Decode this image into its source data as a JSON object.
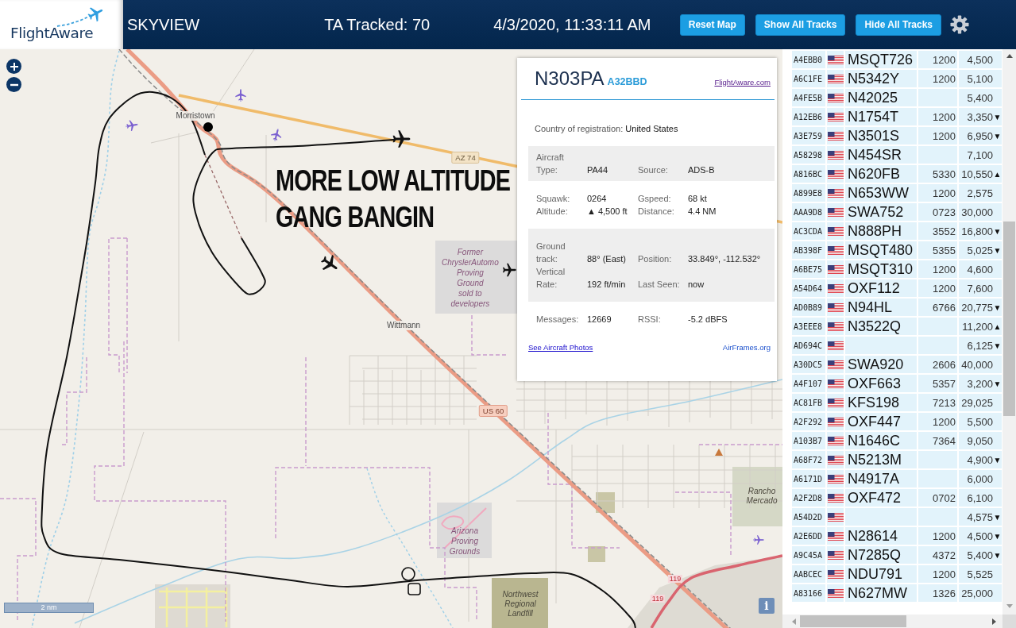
{
  "header": {
    "logo": "FlightAware",
    "app_name": "SKYVIEW",
    "tracked": "TA Tracked: 70",
    "datetime": "4/3/2020, 11:33:11 AM",
    "buttons": [
      "Reset Map",
      "Show All Tracks",
      "Hide All Tracks"
    ]
  },
  "map": {
    "annotation": [
      "MORE LOW ALTITUDE",
      "GANG BANGIN"
    ],
    "labels": [
      {
        "kind": "place",
        "lines": [
          "Morristown"
        ]
      },
      {
        "kind": "state-shield",
        "lines": [
          "AZ 74"
        ]
      },
      {
        "kind": "area",
        "lines": [
          "Former",
          "ChryslerAutomo",
          "Proving",
          "Ground",
          "sold to",
          "developers"
        ]
      },
      {
        "kind": "place",
        "lines": [
          "Wittmann"
        ]
      },
      {
        "kind": "us-shield",
        "lines": [
          "US 60"
        ]
      },
      {
        "kind": "area",
        "lines": [
          "Arizona",
          "Proving",
          "Grounds"
        ]
      },
      {
        "kind": "landuse",
        "lines": [
          "Northwest",
          "Regional",
          "Landfill"
        ]
      },
      {
        "kind": "landuse",
        "lines": [
          "Rancho",
          "Mercado"
        ]
      },
      {
        "kind": "route",
        "lines": [
          "119"
        ]
      },
      {
        "kind": "route",
        "lines": [
          "119"
        ]
      }
    ],
    "scale": "2 nm",
    "info_button": "i"
  },
  "popup": {
    "callsign": "N303PA",
    "hex": "A32BBD",
    "site_link": "FlightAware.com",
    "country_label": "Country of registration:",
    "country": "United States",
    "sections": [
      {
        "shaded": true,
        "rows": [
          [
            {
              "label": "Aircraft Type:",
              "value": "PA44"
            },
            {
              "label": "Source:",
              "value": "ADS-B"
            }
          ]
        ]
      },
      {
        "shaded": false,
        "rows": [
          [
            {
              "label": "Squawk:",
              "value": "0264"
            },
            {
              "label": "Gspeed:",
              "value": "68 kt"
            }
          ],
          [
            {
              "label": "Altitude:",
              "value": "▲ 4,500 ft"
            },
            {
              "label": "Distance:",
              "value": "4.4 NM"
            }
          ]
        ]
      },
      {
        "shaded": true,
        "rows": [
          [
            {
              "label": "Ground track:",
              "value": "88° (East)"
            },
            {
              "label": "Position:",
              "value": "33.849°, -112.532°"
            }
          ],
          [
            {
              "label": "Vertical Rate:",
              "value": "192 ft/min"
            },
            {
              "label": "Last Seen:",
              "value": "now"
            }
          ]
        ]
      },
      {
        "shaded": false,
        "rows": [
          [
            {
              "label": "Messages:",
              "value": "12669"
            },
            {
              "label": "RSSI:",
              "value": "-5.2 dBFS"
            }
          ]
        ]
      }
    ],
    "photos_link": "See Aircraft Photos",
    "airframes_link": "AirFrames.org"
  },
  "aircraft_table": {
    "rows": [
      {
        "hex": "A4EBB0",
        "callsign": "MSQT726",
        "squawk": "1200",
        "altitude": "4,500"
      },
      {
        "hex": "A6C1FE",
        "callsign": "N5342Y",
        "squawk": "1200",
        "altitude": "5,100"
      },
      {
        "hex": "A4FE5B",
        "callsign": "N42025",
        "altitude": "5,400"
      },
      {
        "hex": "A12EB6",
        "callsign": "N1754T",
        "squawk": "1200",
        "altitude": "3,350",
        "trend": "▼"
      },
      {
        "hex": "A3E759",
        "callsign": "N3501S",
        "squawk": "1200",
        "altitude": "6,950",
        "trend": "▼"
      },
      {
        "hex": "A58298",
        "callsign": "N454SR",
        "altitude": "7,100"
      },
      {
        "hex": "A816BC",
        "callsign": "N620FB",
        "squawk": "5330",
        "altitude": "10,550",
        "trend": "▲"
      },
      {
        "hex": "A899E8",
        "callsign": "N653WW",
        "squawk": "1200",
        "altitude": "2,575"
      },
      {
        "hex": "AAA9D8",
        "callsign": "SWA752",
        "squawk": "0723",
        "altitude": "30,000"
      },
      {
        "hex": "AC3CDA",
        "callsign": "N888PH",
        "squawk": "3552",
        "altitude": "16,800",
        "trend": "▼"
      },
      {
        "hex": "AB398F",
        "callsign": "MSQT480",
        "squawk": "5355",
        "altitude": "5,025",
        "trend": "▼"
      },
      {
        "hex": "A6BE75",
        "callsign": "MSQT310",
        "squawk": "1200",
        "altitude": "4,600"
      },
      {
        "hex": "A54D64",
        "callsign": "OXF112",
        "squawk": "1200",
        "altitude": "7,600"
      },
      {
        "hex": "AD0B89",
        "callsign": "N94HL",
        "squawk": "6766",
        "altitude": "20,775",
        "trend": "▼"
      },
      {
        "hex": "A3EEE8",
        "callsign": "N3522Q",
        "altitude": "11,200",
        "trend": "▲"
      },
      {
        "hex": "AD694C",
        "altitude": "6,125",
        "trend": "▼"
      },
      {
        "hex": "A30DC5",
        "callsign": "SWA920",
        "squawk": "2606",
        "altitude": "40,000"
      },
      {
        "hex": "A4F107",
        "callsign": "OXF663",
        "squawk": "5357",
        "altitude": "3,200",
        "trend": "▼"
      },
      {
        "hex": "AC81FB",
        "callsign": "KFS198",
        "squawk": "7213",
        "altitude": "29,025"
      },
      {
        "hex": "A2F292",
        "callsign": "OXF447",
        "squawk": "1200",
        "altitude": "5,500"
      },
      {
        "hex": "A103B7",
        "callsign": "N1646C",
        "squawk": "7364",
        "altitude": "9,050"
      },
      {
        "hex": "A68F72",
        "callsign": "N5213M",
        "altitude": "4,900",
        "trend": "▼"
      },
      {
        "hex": "A6171D",
        "callsign": "N4917A",
        "altitude": "6,000"
      },
      {
        "hex": "A2F2D8",
        "callsign": "OXF472",
        "squawk": "0702",
        "altitude": "6,100"
      },
      {
        "hex": "A54D2D",
        "altitude": "4,575",
        "trend": "▼"
      },
      {
        "hex": "A2E6DD",
        "callsign": "N28614",
        "squawk": "1200",
        "altitude": "4,500",
        "trend": "▼"
      },
      {
        "hex": "A9C45A",
        "callsign": "N7285Q",
        "squawk": "4372",
        "altitude": "5,400",
        "trend": "▼"
      },
      {
        "hex": "AABCEC",
        "callsign": "NDU791",
        "squawk": "1200",
        "altitude": "5,525"
      },
      {
        "hex": "A83166",
        "callsign": "N627MW",
        "squawk": "1326",
        "altitude": "25,000"
      }
    ]
  }
}
